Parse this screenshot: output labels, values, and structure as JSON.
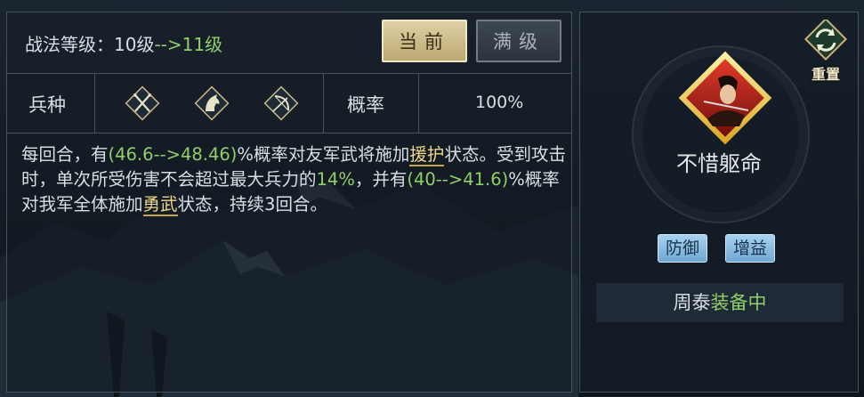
{
  "skill_panel": {
    "level_prefix": "战法等级：10级",
    "level_arrow": "-->",
    "level_next": "11级",
    "tabs": {
      "current": "当前",
      "max": "满级"
    },
    "troop_label": "兵种",
    "troop_icons": [
      "spear-cavalry-icon",
      "horse-icon",
      "bow-icon"
    ],
    "probability_label": "概率",
    "probability_value": "100%",
    "description": {
      "p1": "每回合，有",
      "p2": "(46.6-->48.46)",
      "p3": "%概率对友军武将施加",
      "p4": "援护",
      "p5": "状态。受到攻击时，单次所受伤害不会超过最大兵力的",
      "p6": "14%",
      "p7": "，并有",
      "p8": "(40-->41.6)",
      "p9": "%概率对我军全体施加",
      "p10": "勇武",
      "p11": "状态，持续3回合。"
    }
  },
  "skill_card": {
    "reset_label": "重置",
    "skill_name": "不惜躯命",
    "tags": [
      "防御",
      "增益"
    ],
    "equipped_general": "周泰",
    "equipped_status": "装备中"
  },
  "colors": {
    "accent_green": "#8fcf6a",
    "accent_gold": "#f0d889",
    "tag_blue": "#6fa8d4"
  }
}
